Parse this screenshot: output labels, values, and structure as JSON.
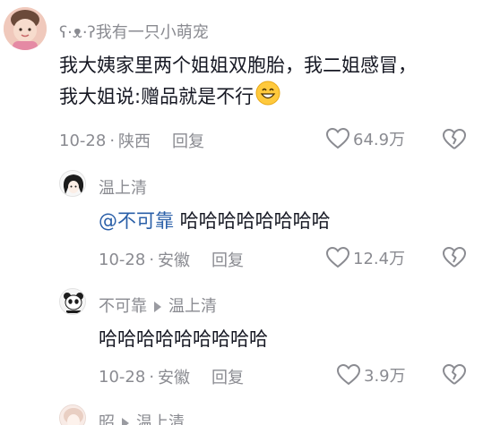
{
  "comments": [
    {
      "username": "ʕ·ᴥ·ʔ我有一只小萌宠",
      "lines": [
        "我大姨家里两个姐姐双胞胎，我二姐感冒，",
        "我大姐说:赠品就是不行"
      ],
      "date": "10-28",
      "location": "陕西",
      "reply_label": "回复",
      "likes": "64.9万"
    },
    {
      "username": "温上清",
      "mention": "@不可靠",
      "text": " 哈哈哈哈哈哈哈哈",
      "date": "10-28",
      "location": "安徽",
      "reply_label": "回复",
      "likes": "12.4万"
    },
    {
      "username": "不可靠",
      "reply_to": "温上清",
      "text": "哈哈哈哈哈哈哈哈哈",
      "date": "10-28",
      "location": "安徽",
      "reply_label": "回复",
      "likes": "3.9万"
    },
    {
      "username": "昭",
      "reply_to": "温上清"
    }
  ],
  "separator": "·",
  "icons": {
    "like": "heart-outline-icon",
    "dislike": "broken-heart-icon",
    "emoji": "grinning-emoji"
  },
  "colors": {
    "text": "#161823",
    "secondary": "#8a8b91",
    "mention": "#2a5fa8"
  }
}
